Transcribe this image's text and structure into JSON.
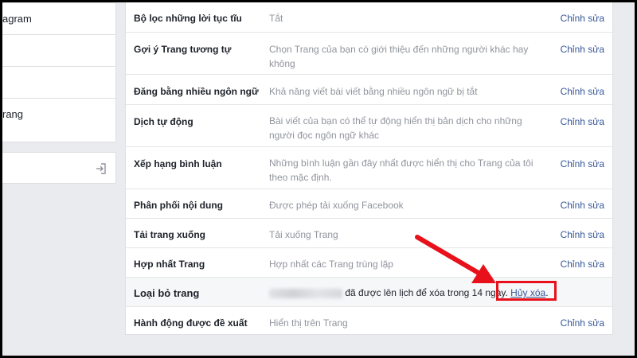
{
  "sidebar": {
    "items": [
      {
        "label": "agram"
      },
      {
        "label": ""
      },
      {
        "label": ""
      },
      {
        "label": "rang"
      }
    ]
  },
  "settings": {
    "edit_label": "Chỉnh sửa",
    "rows": [
      {
        "label": "Bộ lọc những lời tục tĩu",
        "value": "Tắt"
      },
      {
        "label": "Gợi ý Trang tương tự",
        "value": "Chọn Trang của bạn có giới thiệu đến những người khác hay không"
      },
      {
        "label": "Đăng bằng nhiều ngôn ngữ",
        "value": "Khả năng viết bài viết bằng nhiều ngôn ngữ bị tắt"
      },
      {
        "label": "Dịch tự động",
        "value": "Bài viết của bạn có thể tự động hiển thị bản dịch cho những người đọc ngôn ngữ khác"
      },
      {
        "label": "Xếp hạng bình luận",
        "value": "Những bình luận gần đây nhất được hiển thị cho Trang của tôi theo mặc định."
      },
      {
        "label": "Phân phối nội dung",
        "value": "Được phép tải xuống Facebook"
      },
      {
        "label": "Tải trang xuống",
        "value": "Tải xuống Trang"
      },
      {
        "label": "Hợp nhất Trang",
        "value": "Hợp nhất các Trang trùng lặp"
      }
    ],
    "remove": {
      "label": "Loại bỏ trang",
      "message": "đã được lên lịch để xóa trong 14 ngày.",
      "undo_link": "Hủy xóa",
      "period": "."
    },
    "last": {
      "label": "Hành động được đề xuất",
      "value": "Hiển thị trên Trang"
    }
  },
  "colors": {
    "link": "#365899",
    "highlight_box": "#e8111b",
    "arrow": "#e8111b"
  }
}
